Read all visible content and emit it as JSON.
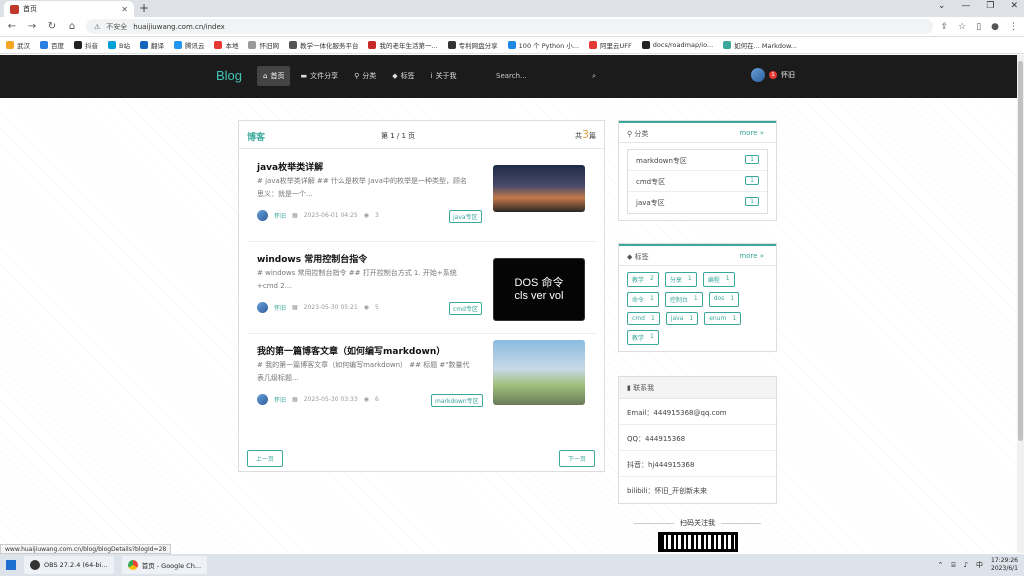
{
  "browser": {
    "tab_title": "首页",
    "new_tab": "+",
    "insecure_label": "不安全",
    "url": "huaijiuwang.com.cn/index",
    "bookmarks": [
      "武汉",
      "百度",
      "抖音",
      "B站",
      "翻译",
      "腾讯云",
      "本地",
      "怀旧网",
      "教学一体化服务平台",
      "我的老年生活第一...",
      "专利网盘分享",
      "100 个 Python 小...",
      "阿里云UFF",
      "docs/roadmap/io...",
      "如何在... Markdow..."
    ]
  },
  "nav": {
    "brand": "Blog",
    "items": [
      "首页",
      "文件分享",
      "分类",
      "标签",
      "关于我"
    ],
    "search_placeholder": "Search...",
    "user_badge": "1",
    "username": "怀旧"
  },
  "blog": {
    "title": "博客",
    "page_info": "第 1 / 1 页",
    "total_prefix": "共",
    "total": "3",
    "total_suffix": "篇",
    "posts": [
      {
        "title": "java枚举类详解",
        "excerpt": "# java枚举类详解 ## 什么是枚举 Java中的枚举是一种类型，顾名思义：就是一个...",
        "author": "怀旧",
        "date": "2023-06-01 04:25",
        "views": "3",
        "tag": "java专区"
      },
      {
        "title": "windows 常用控制台指令",
        "excerpt": "# windows 常用控制台指令 ## 打开控制台方式 1. 开始+系统+cmd 2...",
        "author": "怀旧",
        "date": "2023-05-30 05:21",
        "views": "5",
        "tag": "cmd专区",
        "thumb_lines": [
          "DOS 命令",
          "cls  ver  vol"
        ]
      },
      {
        "title": "我的第一篇博客文章（如何编写markdown）",
        "excerpt": "# 我的第一篇博客文章（如何编写markdown） ## 标题 #\"数量代表几级标题...",
        "author": "怀旧",
        "date": "2023-05-30 03:33",
        "views": "6",
        "tag": "markdown专区"
      }
    ],
    "prev": "上一页",
    "next": "下一页"
  },
  "categories": {
    "title": "分类",
    "more": "more",
    "items": [
      {
        "name": "markdown专区",
        "count": "1"
      },
      {
        "name": "cmd专区",
        "count": "1"
      },
      {
        "name": "java专区",
        "count": "1"
      }
    ]
  },
  "tags": {
    "title": "标签",
    "more": "more",
    "items": [
      {
        "name": "教学",
        "count": "2"
      },
      {
        "name": "分享",
        "count": "1"
      },
      {
        "name": "编程",
        "count": "1"
      },
      {
        "name": "命令",
        "count": "1"
      },
      {
        "name": "控制台",
        "count": "1"
      },
      {
        "name": "dos",
        "count": "1"
      },
      {
        "name": "cmd",
        "count": "1"
      },
      {
        "name": "java",
        "count": "1"
      },
      {
        "name": "enum",
        "count": "1"
      },
      {
        "name": "教学",
        "count": "1"
      }
    ]
  },
  "contact": {
    "title": "联系我",
    "rows": [
      "Email：444915368@qq.com",
      "QQ：444915368",
      "抖音：hj444915368",
      "bilibili：怀旧_开创新未来"
    ]
  },
  "qr": {
    "title": "扫码关注我"
  },
  "status_url": "www.huaijiuwang.com.cn/blog/blogDetails?blogId=28",
  "taskbar": {
    "apps": [
      "OBS 27.2.4 (64-bi...",
      "首页 - Google Ch..."
    ],
    "time": "17:29:26",
    "date": "2023/6/1"
  },
  "colors": {
    "accent": "#3aa89a",
    "nav_bg": "#1b1b1b",
    "total_number": "#e8a33c"
  }
}
